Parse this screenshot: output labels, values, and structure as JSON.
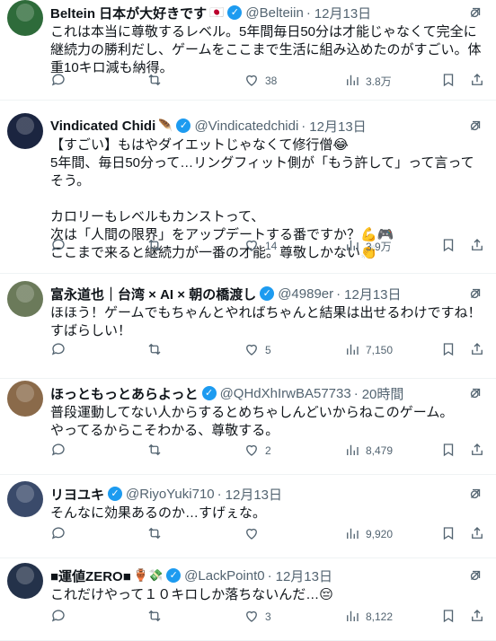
{
  "tweets": [
    {
      "name": "Beltein 日本が大好きです",
      "badge": "🇯🇵",
      "handle": "@Belteiin",
      "time": "12月13日",
      "text": "これは本当に尊敬するレベル。5年間毎日50分は才能じゃなくて完全に継続力の勝利だし、ゲームをここまで生活に組み込めたのがすごい。体重10キロ減も納得。",
      "reply": "",
      "retweet": "",
      "like": "38",
      "views": "3.8万",
      "avatar_color": "#2e6b3a"
    },
    {
      "name": "Vindicated Chidi",
      "badge": "🪶",
      "handle": "@Vindicatedchidi",
      "time": "12月13日",
      "text": "【すごい】もはやダイエットじゃなくて修行僧😂\n5年間、毎日50分って…リングフィット側が「もう許して」って言ってそう。\n\nカロリーもレベルもカンストって、\n次は「人間の限界」をアップデートする番ですか？💪🎮\nここまで来ると継続力が一番の才能。尊敬しかない👏",
      "reply": "",
      "retweet": "",
      "like": "14",
      "views": "3.9万",
      "avatar_color": "#1b2540"
    },
    {
      "name": "富永道也｜台湾 × AI × 朝の橋渡し",
      "badge": "",
      "handle": "@4989er",
      "time": "12月13日",
      "text": "ほほう！ゲームでもちゃんとやればちゃんと結果は出せるわけですね！すばらしい！",
      "reply": "",
      "retweet": "",
      "like": "5",
      "views": "7,150",
      "avatar_color": "#6b7a5a"
    },
    {
      "name": "ほっともっとあらよっと",
      "badge": "",
      "handle": "@QHdXhIrwBA57733",
      "time": "20時間",
      "text": "普段運動してない人からするとめちゃしんどいからねこのゲーム。\nやってるからこそわかる、尊敬する。",
      "reply": "",
      "retweet": "",
      "like": "2",
      "views": "8,479",
      "avatar_color": "#8a6a4a"
    },
    {
      "name": "リヨユキ",
      "badge": "",
      "handle": "@RiyoYuki710",
      "time": "12月13日",
      "text": "そんなに効果あるのか…すげぇな。",
      "reply": "",
      "retweet": "",
      "like": "",
      "views": "9,920",
      "avatar_color": "#3a4a6a"
    },
    {
      "name": "■運値ZERO■",
      "badge": "🏺💸",
      "handle": "@LackPoint0",
      "time": "12月13日",
      "text": "これだけやって１０キロしか落ちないんだ…😔",
      "reply": "",
      "retweet": "",
      "like": "3",
      "views": "8,122",
      "avatar_color": "#24324a"
    }
  ],
  "icons": {
    "reply": "reply-icon",
    "retweet": "retweet-icon",
    "like": "like-icon",
    "views": "views-icon",
    "bookmark": "bookmark-icon",
    "share": "share-icon",
    "grok": "grok-icon"
  }
}
